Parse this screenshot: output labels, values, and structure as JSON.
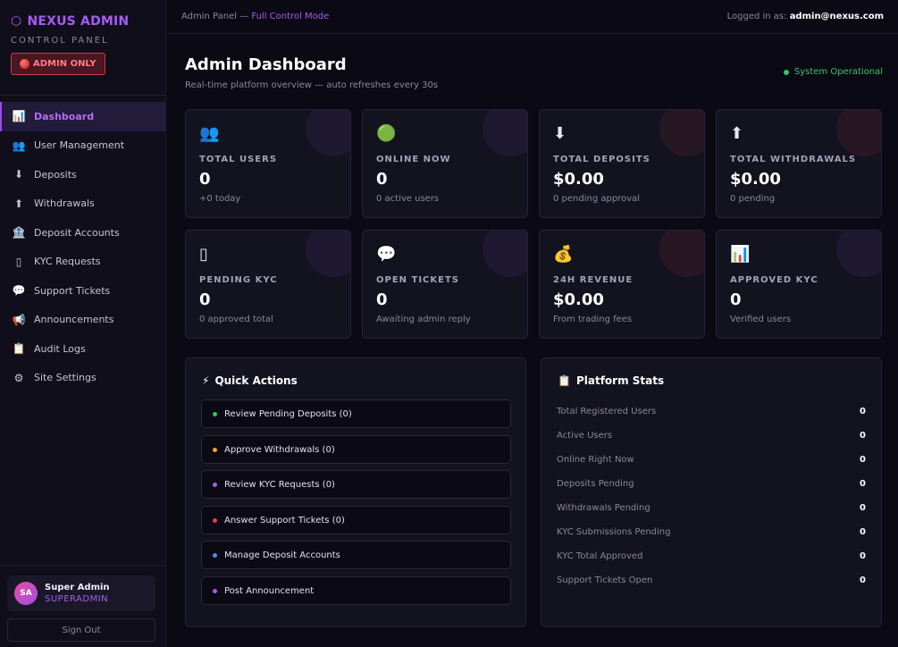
{
  "brand": {
    "title": "NEXUS ADMIN",
    "subtitle": "CONTROL PANEL",
    "badge": "ADMIN ONLY"
  },
  "nav": [
    {
      "label": "Dashboard",
      "icon": "📊",
      "active": true
    },
    {
      "label": "User Management",
      "icon": "👥"
    },
    {
      "label": "Deposits",
      "icon": "⬇"
    },
    {
      "label": "Withdrawals",
      "icon": "⬆"
    },
    {
      "label": "Deposit Accounts",
      "icon": "🏦"
    },
    {
      "label": "KYC Requests",
      "icon": "▯"
    },
    {
      "label": "Support Tickets",
      "icon": "💬"
    },
    {
      "label": "Announcements",
      "icon": "📢"
    },
    {
      "label": "Audit Logs",
      "icon": "📋"
    },
    {
      "label": "Site Settings",
      "icon": "⚙"
    }
  ],
  "user": {
    "initials": "SA",
    "name": "Super Admin",
    "role": "SUPERADMIN"
  },
  "signout": "Sign Out",
  "topbar": {
    "prefix": "Admin Panel — ",
    "mode": "Full Control Mode",
    "logged_prefix": "Logged in as: ",
    "email": "admin@nexus.com"
  },
  "page": {
    "title": "Admin Dashboard",
    "subtitle": "Real-time platform overview — auto refreshes every 30s",
    "status": "System Operational"
  },
  "cards": [
    {
      "icon": "👥",
      "label": "TOTAL USERS",
      "value": "0",
      "sub": "+0 today"
    },
    {
      "icon": "🟢",
      "label": "ONLINE NOW",
      "value": "0",
      "sub": "0 active users"
    },
    {
      "icon": "⬇",
      "label": "TOTAL DEPOSITS",
      "value": "$0.00",
      "sub": "0 pending approval"
    },
    {
      "icon": "⬆",
      "label": "TOTAL WITHDRAWALS",
      "value": "$0.00",
      "sub": "0 pending"
    },
    {
      "icon": "▯",
      "label": "PENDING KYC",
      "value": "0",
      "sub": "0 approved total"
    },
    {
      "icon": "💬",
      "label": "OPEN TICKETS",
      "value": "0",
      "sub": "Awaiting admin reply"
    },
    {
      "icon": "💰",
      "label": "24H REVENUE",
      "value": "$0.00",
      "sub": "From trading fees"
    },
    {
      "icon": "📊",
      "label": "APPROVED KYC",
      "value": "0",
      "sub": "Verified users"
    }
  ],
  "quick_actions": {
    "title": "Quick Actions",
    "icon": "⚡",
    "items": [
      {
        "label": "Review Pending Deposits (0)",
        "color": "#35c46a"
      },
      {
        "label": "Approve Withdrawals (0)",
        "color": "#f0a23a"
      },
      {
        "label": "Review KYC Requests (0)",
        "color": "#a55cf0"
      },
      {
        "label": "Answer Support Tickets (0)",
        "color": "#e0424f"
      },
      {
        "label": "Manage Deposit Accounts",
        "color": "#4a8cf0"
      },
      {
        "label": "Post Announcement",
        "color": "#a55cf0"
      }
    ]
  },
  "platform_stats": {
    "title": "Platform Stats",
    "icon": "📋",
    "rows": [
      {
        "label": "Total Registered Users",
        "value": "0"
      },
      {
        "label": "Active Users",
        "value": "0"
      },
      {
        "label": "Online Right Now",
        "value": "0"
      },
      {
        "label": "Deposits Pending",
        "value": "0"
      },
      {
        "label": "Withdrawals Pending",
        "value": "0"
      },
      {
        "label": "KYC Submissions Pending",
        "value": "0"
      },
      {
        "label": "KYC Total Approved",
        "value": "0"
      },
      {
        "label": "Support Tickets Open",
        "value": "0"
      }
    ]
  }
}
